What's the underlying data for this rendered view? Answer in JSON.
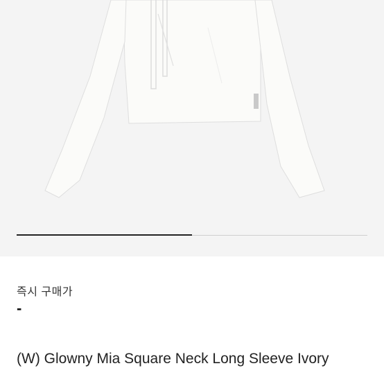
{
  "product": {
    "image_alt": "Glowny Mia Square Neck Long Sleeve Ivory product photo",
    "image_count_progress": 0.5,
    "price_label": "즉시 구매가",
    "price_value": "-",
    "title": "(W) Glowny Mia Square Neck Long Sleeve Ivory"
  },
  "colors": {
    "image_bg": "#f4f4f4",
    "garment": "#fbfbf9",
    "progress": "#222222",
    "track": "#cfcfcf"
  }
}
